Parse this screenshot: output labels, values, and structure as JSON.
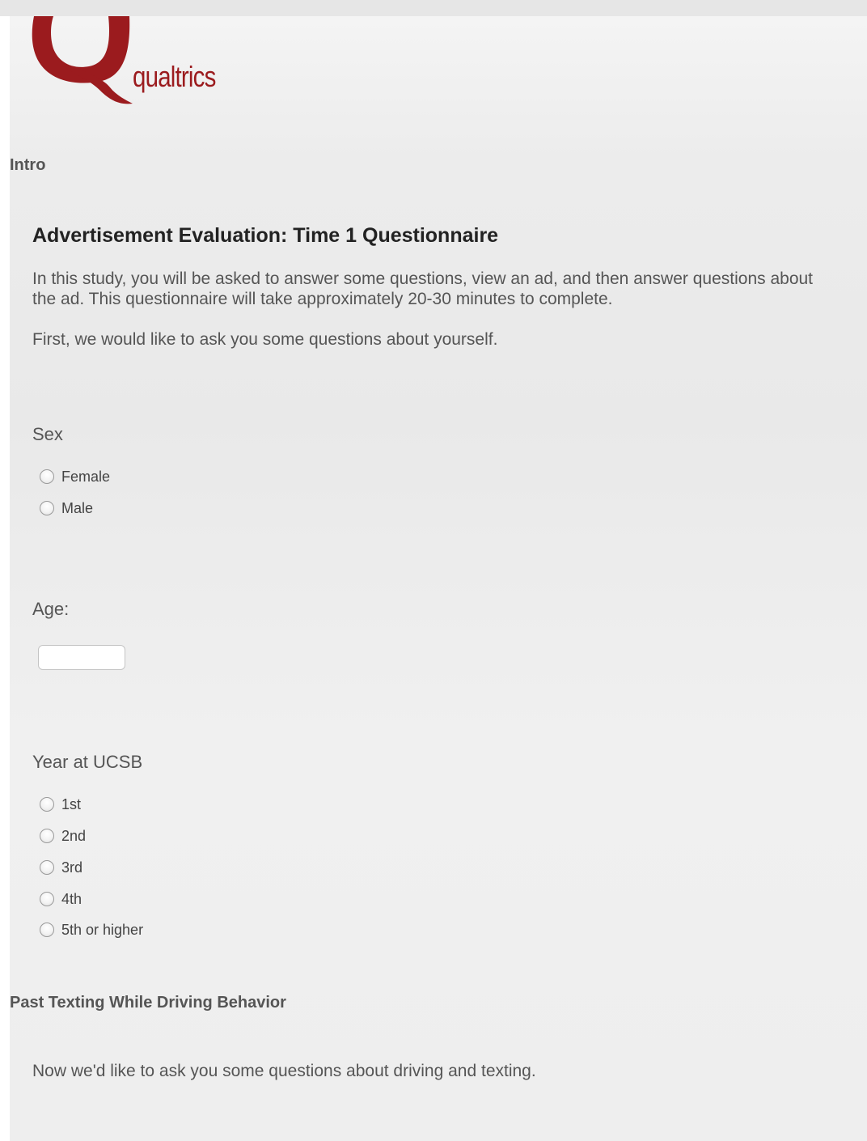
{
  "brand": {
    "name": "qualtrics",
    "color": "#9b1b1e",
    "icon": "qualtrics-q-logo-icon"
  },
  "blocks": [
    {
      "title": "Intro",
      "heading": "Advertisement Evaluation: Time 1 Questionnaire",
      "paragraphs": [
        "In this study, you will be asked to answer some questions, view an ad, and then answer questions about the ad. This questionnaire will take approximately 20-30 minutes to complete.",
        "First, we would like to ask you some questions about yourself."
      ]
    },
    {
      "title": "Past Texting While Driving Behavior",
      "paragraphs": [
        "Now we'd like to ask you some questions about driving and texting."
      ]
    }
  ],
  "questions": {
    "sex": {
      "label": "Sex",
      "options": [
        "Female",
        "Male"
      ],
      "selected": null
    },
    "age": {
      "label": "Age:",
      "value": "",
      "placeholder": ""
    },
    "year": {
      "label": "Year at UCSB",
      "options": [
        "1st",
        "2nd",
        "3rd",
        "4th",
        "5th or higher"
      ],
      "selected": null
    }
  }
}
